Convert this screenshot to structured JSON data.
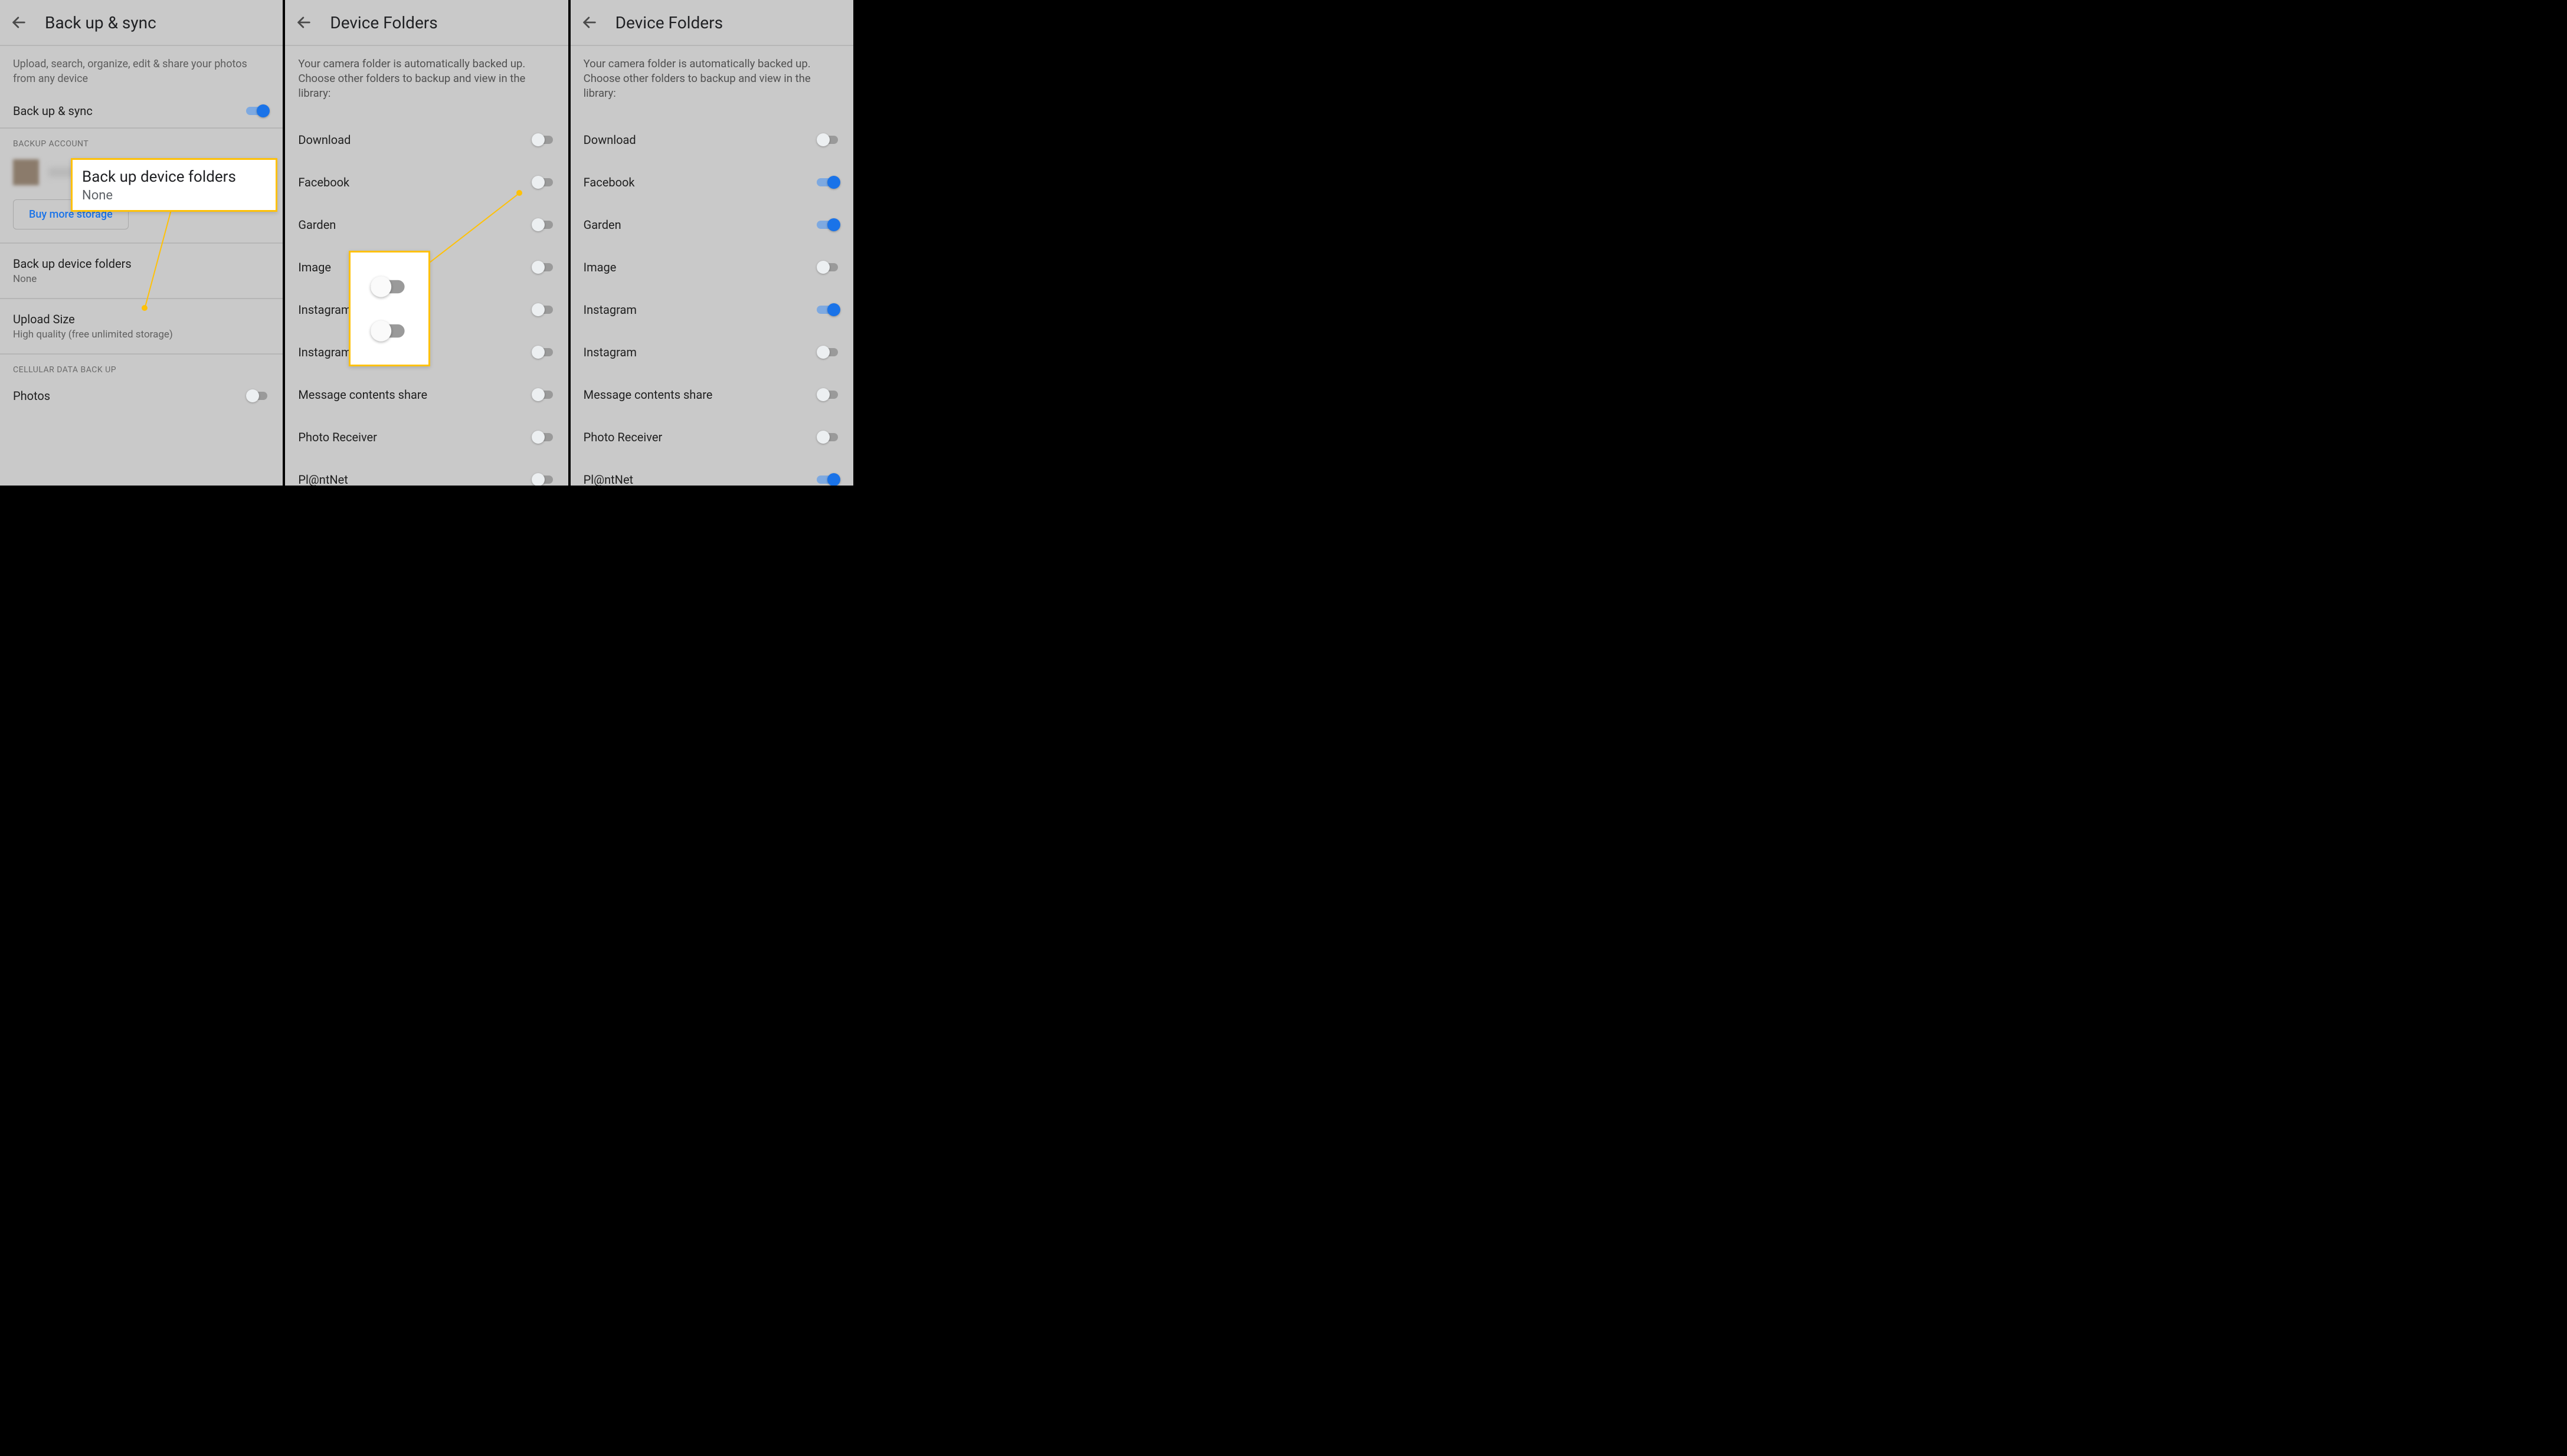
{
  "panel1": {
    "title": "Back up & sync",
    "description": "Upload, search, organize, edit & share your photos from any device",
    "backup_sync_label": "Back up & sync",
    "backup_sync_on": true,
    "backup_account_section": "BACKUP ACCOUNT",
    "buy_storage_label": "Buy more storage",
    "folders_title": "Back up device folders",
    "folders_value": "None",
    "upload_title": "Upload Size",
    "upload_value": "High quality (free unlimited storage)",
    "cellular_section": "CELLULAR DATA BACK UP",
    "photos_label": "Photos",
    "photos_on": false,
    "callout_title": "Back up device folders",
    "callout_value": "None"
  },
  "panel2": {
    "title": "Device Folders",
    "description": "Your camera folder is automatically backed up. Choose other folders to backup and view in the library:",
    "folders": [
      {
        "name": "Download",
        "on": false
      },
      {
        "name": "Facebook",
        "on": false
      },
      {
        "name": "Garden",
        "on": false
      },
      {
        "name": "Image",
        "on": false
      },
      {
        "name": "Instagram",
        "on": false
      },
      {
        "name": "Instagram",
        "on": false
      },
      {
        "name": "Message contents share",
        "on": false
      },
      {
        "name": "Photo Receiver",
        "on": false
      },
      {
        "name": "Pl@ntNet",
        "on": false
      }
    ],
    "callout_toggles": [
      false,
      false
    ]
  },
  "panel3": {
    "title": "Device Folders",
    "description": "Your camera folder is automatically backed up. Choose other folders to backup and view in the library:",
    "folders": [
      {
        "name": "Download",
        "on": false
      },
      {
        "name": "Facebook",
        "on": true
      },
      {
        "name": "Garden",
        "on": true
      },
      {
        "name": "Image",
        "on": false
      },
      {
        "name": "Instagram",
        "on": true
      },
      {
        "name": "Instagram",
        "on": false
      },
      {
        "name": "Message contents share",
        "on": false
      },
      {
        "name": "Photo Receiver",
        "on": false
      },
      {
        "name": "Pl@ntNet",
        "on": true
      }
    ]
  }
}
